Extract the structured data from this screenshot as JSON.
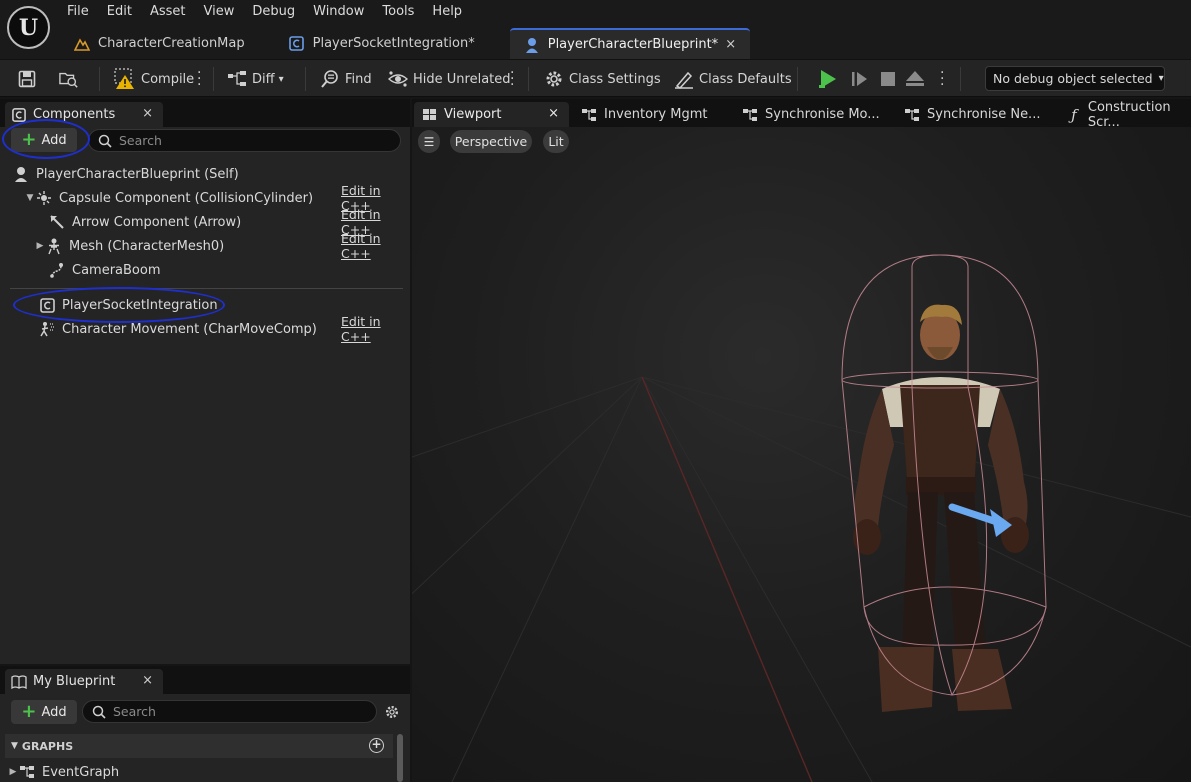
{
  "menu": [
    "File",
    "Edit",
    "Asset",
    "View",
    "Debug",
    "Window",
    "Tools",
    "Help"
  ],
  "doc_tabs": [
    {
      "label": "CharacterCreationMap",
      "icon": "level-map-icon"
    },
    {
      "label": "PlayerSocketIntegration*",
      "icon": "blueprint-component-icon"
    },
    {
      "label": "PlayerCharacterBlueprint*",
      "icon": "character-blueprint-icon",
      "close": "×"
    }
  ],
  "toolbar": {
    "compile": "Compile",
    "diff": "Diff",
    "find": "Find",
    "hide_unrelated": "Hide Unrelated",
    "class_settings": "Class Settings",
    "class_defaults": "Class Defaults",
    "debug_object": "No debug object selected"
  },
  "components": {
    "tab_label": "Components",
    "close": "×",
    "add_label": "Add",
    "search_placeholder": "Search",
    "self_label": "PlayerCharacterBlueprint (Self)",
    "items": [
      {
        "label": "Capsule Component (CollisionCylinder)",
        "edit": "Edit in C++",
        "icon": "capsule-icon"
      },
      {
        "label": "Arrow Component (Arrow)",
        "edit": "Edit in C++",
        "icon": "arrow-component-icon"
      },
      {
        "label": "Mesh (CharacterMesh0)",
        "edit": "Edit in C++",
        "icon": "skeletal-mesh-icon"
      },
      {
        "label": "CameraBoom",
        "edit": "",
        "icon": "spring-arm-icon"
      },
      {
        "label": "PlayerSocketIntegration",
        "edit": "",
        "icon": "blueprint-component-icon"
      },
      {
        "label": "Character Movement (CharMoveComp)",
        "edit": "Edit in C++",
        "icon": "movement-icon"
      }
    ]
  },
  "my_blueprint": {
    "tab_label": "My Blueprint",
    "close": "×",
    "add_label": "Add",
    "search_placeholder": "Search",
    "section": "GRAPHS",
    "graph_item": "EventGraph"
  },
  "viewport": {
    "tabs": [
      {
        "label": "Viewport",
        "close": "×"
      },
      {
        "label": "Inventory Mgmt"
      },
      {
        "label": "Synchronise Mo..."
      },
      {
        "label": "Synchronise Ne..."
      },
      {
        "label": "Construction Scr..."
      }
    ],
    "perspective": "Perspective",
    "lit": "Lit"
  },
  "colors": {
    "annotation": "#1e2fd0",
    "compile_warning": "#e8b400",
    "play_green": "#4cc24c",
    "active_tab_accent": "#3a6bd6",
    "selected_arrow_component": "#6aa8f0",
    "collision_wire": "#c98a96"
  }
}
